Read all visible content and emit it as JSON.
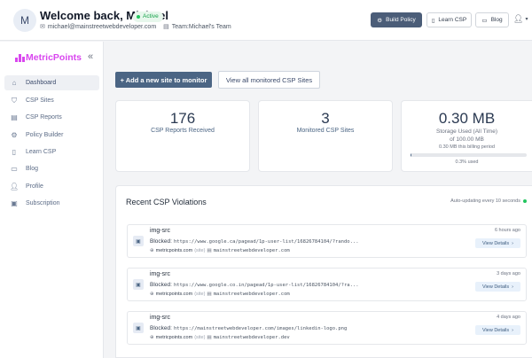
{
  "header": {
    "avatar_initial": "M",
    "welcome": "Welcome back, Michael",
    "status_badge": "Active",
    "email": "michael@mainstreetwebdeveloper.com",
    "team": "Team:Michael's Team",
    "buttons": {
      "build_policy": "Build Policy",
      "learn_csp": "Learn CSP",
      "blog": "Blog"
    }
  },
  "sidebar": {
    "brand": "MetricPoints",
    "items": [
      {
        "label": "Dashboard",
        "icon": "home-icon"
      },
      {
        "label": "CSP Sites",
        "icon": "shield-icon"
      },
      {
        "label": "CSP Reports",
        "icon": "document-icon"
      },
      {
        "label": "Policy Builder",
        "icon": "gear-icon"
      },
      {
        "label": "Learn CSP",
        "icon": "book-icon"
      },
      {
        "label": "Blog",
        "icon": "blog-icon"
      },
      {
        "label": "Profile",
        "icon": "user-icon"
      },
      {
        "label": "Subscription",
        "icon": "card-icon"
      }
    ]
  },
  "actions": {
    "add_site": "+ Add a new site to monitor",
    "view_all": "View all monitored CSP Sites"
  },
  "stats": {
    "reports_value": "176",
    "reports_label": "CSP Reports Received",
    "sites_value": "3",
    "sites_label": "Monitored CSP Sites",
    "storage_value": "0.30 MB",
    "storage_label_1": "Storage Used (All Time)",
    "storage_label_2": "of 100.00 MB",
    "storage_sub": "0.30 MB this billing period",
    "storage_pct": "0.3% used",
    "storage_fraction": 0.003
  },
  "violations": {
    "title": "Recent CSP Violations",
    "auto_update": "Auto-updating every 10 seconds",
    "blocked_label": "Blocked:",
    "view_details": "View Details",
    "items": [
      {
        "type": "img-src",
        "blocked": "https://www.google.ca/pagead/1p-user-list/16826784104/?rando...",
        "site": "metricpoints.com",
        "site_tag": "(site)",
        "doc": "mainstreetwebdeveloper.com",
        "time": "6 hours ago"
      },
      {
        "type": "img-src",
        "blocked": "https://www.google.co.in/pagead/1p-user-list/16826784104/?ra...",
        "site": "metricpoints.com",
        "site_tag": "(site)",
        "doc": "mainstreetwebdeveloper.com",
        "time": "3 days ago"
      },
      {
        "type": "img-src",
        "blocked": "https://mainstreetwebdeveloper.com/images/linkedin-logo.png",
        "site": "metricpoints.com",
        "site_tag": "(site)",
        "doc": "mainstreetwebdeveloper.dev",
        "time": "4 days ago"
      }
    ]
  }
}
